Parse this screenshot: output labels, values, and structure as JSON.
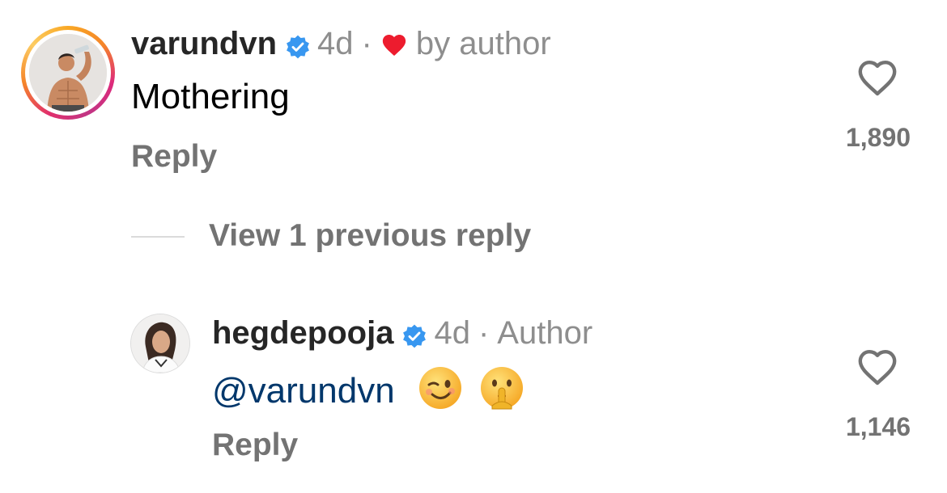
{
  "comment": {
    "username": "varundvn",
    "verified": true,
    "time": "4d",
    "separator": "·",
    "liked_by": "by author",
    "text": "Mothering",
    "reply_label": "Reply",
    "like_count": "1,890",
    "ring_colors": [
      "#f9a825",
      "#dd2a7b",
      "#c13584"
    ]
  },
  "thread": {
    "view_previous_label": "View 1 previous reply"
  },
  "reply": {
    "username": "hegdepooja",
    "verified": true,
    "time": "4d",
    "separator": "·",
    "badge": "Author",
    "mention": "@varundvn",
    "emojis": [
      "winking-face",
      "shushing-face"
    ],
    "reply_label": "Reply",
    "like_count": "1,146"
  },
  "colors": {
    "text_primary": "#262626",
    "text_secondary": "#737373",
    "verified": "#3897f0",
    "heart": "#ed1c2e",
    "mention": "#00376b"
  }
}
